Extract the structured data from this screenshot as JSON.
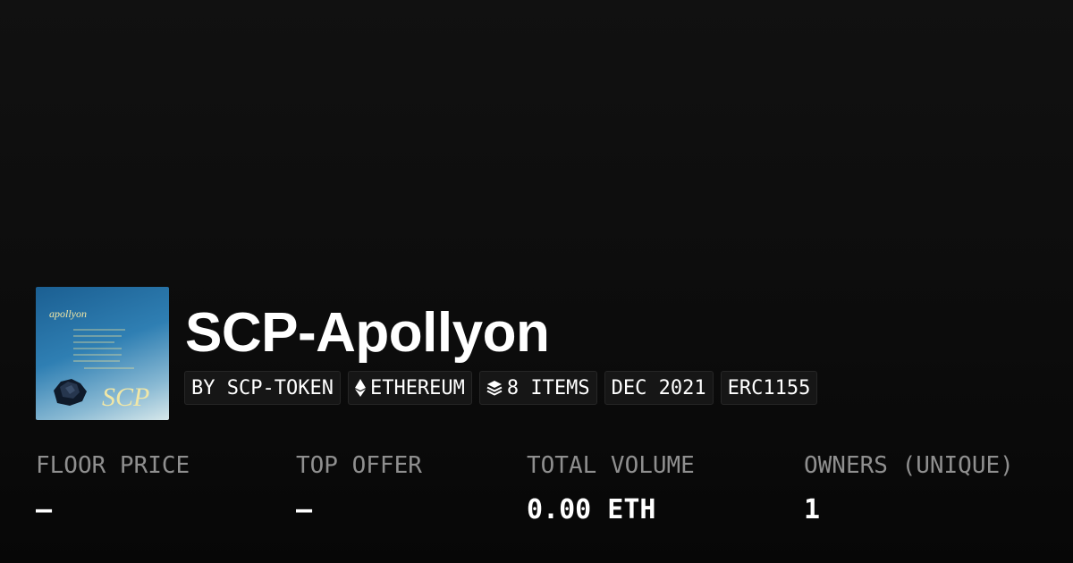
{
  "collection": {
    "name": "SCP-Apollyon",
    "thumbnail": {
      "heading": "apollyon",
      "monogram": "SCP",
      "background_color": "#2f7fb3",
      "text_color": "#f1e7a6"
    }
  },
  "tags": [
    {
      "label": "BY SCP-TOKEN",
      "icon": null
    },
    {
      "label": "ETHEREUM",
      "icon": "ethereum-icon"
    },
    {
      "label": "8 ITEMS",
      "icon": "layers-icon"
    },
    {
      "label": "DEC 2021",
      "icon": null
    },
    {
      "label": "ERC1155",
      "icon": null
    }
  ],
  "stats": [
    {
      "label": "FLOOR PRICE",
      "value": "—"
    },
    {
      "label": "TOP OFFER",
      "value": "—"
    },
    {
      "label": "TOTAL VOLUME",
      "value": "0.00 ETH"
    },
    {
      "label": "OWNERS (UNIQUE)",
      "value": "1"
    }
  ],
  "colors": {
    "background": "#0c0c0c",
    "tag_background": "#161616",
    "label_gray": "#8f8f8f",
    "text": "#ffffff"
  }
}
